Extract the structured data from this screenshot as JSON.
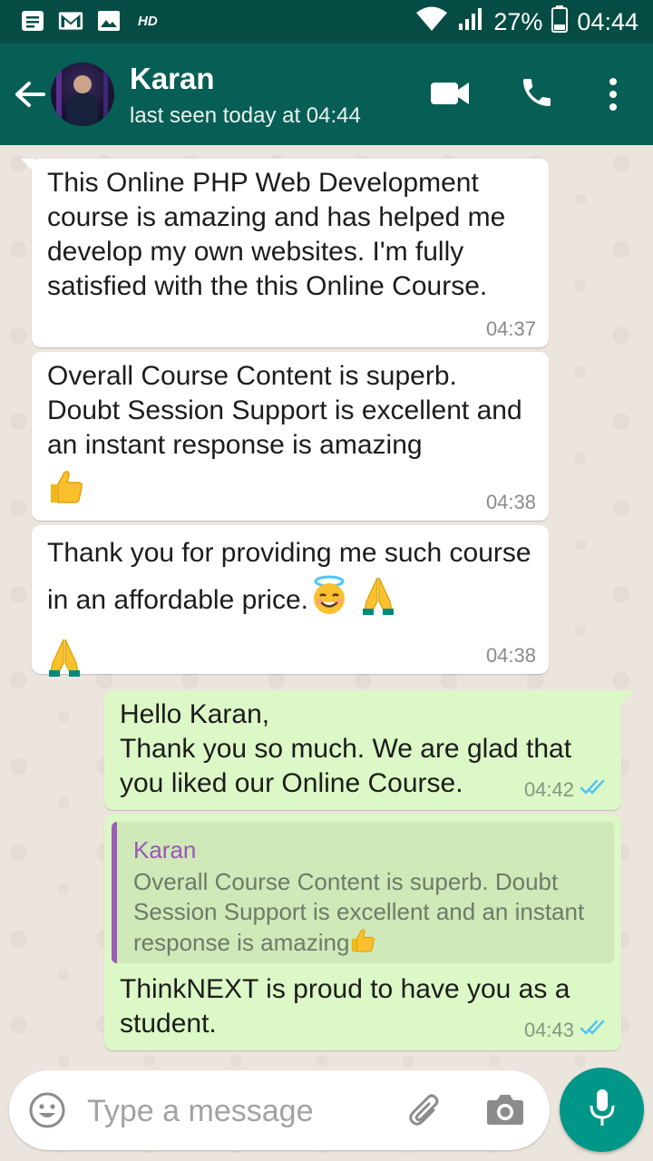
{
  "status_bar": {
    "hd_label": "HD",
    "battery": "27%",
    "time": "04:44"
  },
  "header": {
    "contact_name": "Karan",
    "contact_status": "last seen today at 04:44"
  },
  "messages": [
    {
      "direction": "incoming",
      "text": "This Online PHP Web Development course is amazing and has helped me develop my own websites. I'm fully satisfied with the this Online Course.",
      "time": "04:37"
    },
    {
      "direction": "incoming",
      "text": "Overall Course Content is superb. Doubt Session Support is excellent and an instant response is amazing",
      "emojis_after": [
        "thumbs-up"
      ],
      "time": "04:38"
    },
    {
      "direction": "incoming",
      "text": "Thank you for providing me such course in an affordable price.",
      "emojis_after": [
        "smiling-face-with-halo",
        "folded-hands",
        "folded-hands"
      ],
      "time": "04:38"
    },
    {
      "direction": "outgoing",
      "text_lines": [
        "Hello Karan,",
        "Thank you so much. We are glad that you liked our Online Course."
      ],
      "time": "04:42",
      "status": "read"
    },
    {
      "direction": "outgoing",
      "quoted": {
        "name": "Karan",
        "text": "Overall Course Content is superb. Doubt Session Support is excellent and an instant response is amazing"
      },
      "text": "ThinkNEXT is proud to have you as a student.",
      "time": "04:43",
      "status": "read"
    }
  ],
  "composer": {
    "placeholder": "Type a message"
  },
  "colors": {
    "header": "#075e54",
    "status_bar": "#054d44",
    "chat_background": "#ece5dd",
    "outgoing_bubble": "#dcf8c6",
    "incoming_bubble": "#ffffff",
    "mic_button": "#009688",
    "read_ticks": "#4fc3f7",
    "quote_name": "#9b56b7"
  }
}
